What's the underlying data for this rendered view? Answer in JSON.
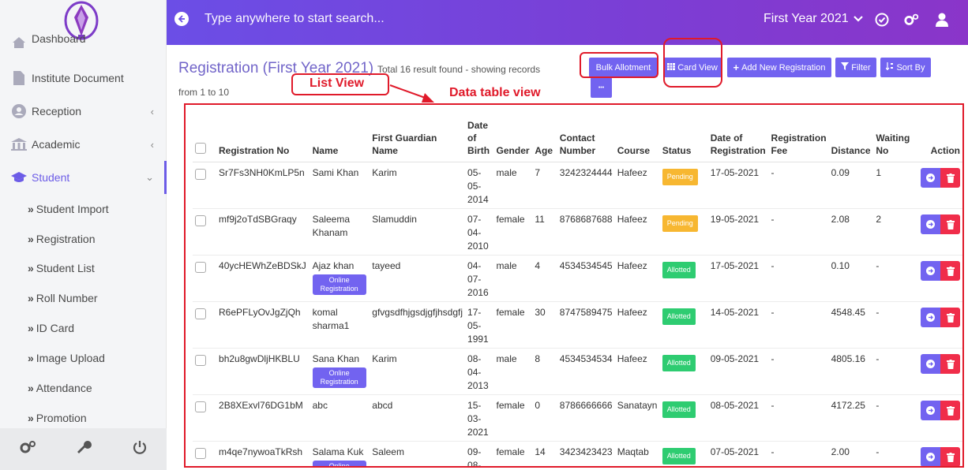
{
  "topbar": {
    "search_placeholder": "Type anywhere to start search...",
    "year": "First Year 2021",
    "accent_gradient": [
      "#6b4ee6",
      "#8a35c9"
    ]
  },
  "sidebar": {
    "items": [
      {
        "label": "Dashboard"
      },
      {
        "label": "Institute Document"
      },
      {
        "label": "Reception"
      },
      {
        "label": "Academic"
      },
      {
        "label": "Student"
      }
    ],
    "sub_items": [
      "Student Import",
      "Registration",
      "Student List",
      "Roll Number",
      "ID Card",
      "Image Upload",
      "Attendance",
      "Promotion"
    ],
    "active_color": "#6c5ce7"
  },
  "header": {
    "title": "Registration (First Year 2021)",
    "result_text": "Total 16 result found - showing records",
    "records_text": "from 1 to 10"
  },
  "toolbar": {
    "bulk_allotment": "Bulk Allotment",
    "card_view": "Card View",
    "add_new": "Add New Registration",
    "filter": "Filter",
    "sort_by": "Sort By",
    "more": "•••"
  },
  "annotations": {
    "list_view": "List View",
    "data_table_view": "Data table view"
  },
  "table": {
    "headers": [
      "Registration No",
      "Name",
      "First Guardian Name",
      "Date of Birth",
      "Gender",
      "Age",
      "Contact Number",
      "Course",
      "Status",
      "Date of Registration",
      "Registration Fee",
      "Distance",
      "Waiting No",
      "Action"
    ],
    "rows": [
      {
        "reg": "Sr7Fs3NH0KmLP5n",
        "name": "Sami Khan",
        "online": "",
        "guardian": "Karim",
        "dob": [
          "05-",
          "05-",
          "2014"
        ],
        "gender": "male",
        "age": "7",
        "contact": "3242324444",
        "course": "Hafeez",
        "status": "Pending",
        "date": "17-05-2021",
        "fee": "-",
        "distance": "0.09",
        "waiting": "1"
      },
      {
        "reg": "mf9j2oTdSBGraqy",
        "name": "Saleema Khanam",
        "online": "",
        "guardian": "Slamuddin",
        "dob": [
          "07-",
          "04-",
          "2010"
        ],
        "gender": "female",
        "age": "11",
        "contact": "8768687688",
        "course": "Hafeez",
        "status": "Pending",
        "date": "19-05-2021",
        "fee": "-",
        "distance": "2.08",
        "waiting": "2"
      },
      {
        "reg": "40ycHEWhZeBDSkJ",
        "name": "Ajaz khan",
        "online": "Online Registration",
        "guardian": "tayeed",
        "dob": [
          "04-",
          "07-",
          "2016"
        ],
        "gender": "male",
        "age": "4",
        "contact": "4534534545",
        "course": "Hafeez",
        "status": "Allotted",
        "date": "17-05-2021",
        "fee": "-",
        "distance": "0.10",
        "waiting": "-"
      },
      {
        "reg": "R6ePFLyOvJgZjQh",
        "name": "komal sharma1",
        "online": "",
        "guardian": "gfvgsdfhjgsdjgfjhsdgfj",
        "dob": [
          "17-",
          "05-",
          "1991"
        ],
        "gender": "female",
        "age": "30",
        "contact": "8747589475",
        "course": "Hafeez",
        "status": "Allotted",
        "date": "14-05-2021",
        "fee": "-",
        "distance": "4548.45",
        "waiting": "-"
      },
      {
        "reg": "bh2u8gwDljHKBLU",
        "name": "Sana Khan",
        "online": "Online Registration",
        "guardian": "Karim",
        "dob": [
          "08-",
          "04-",
          "2013"
        ],
        "gender": "male",
        "age": "8",
        "contact": "4534534534",
        "course": "Hafeez",
        "status": "Allotted",
        "date": "09-05-2021",
        "fee": "-",
        "distance": "4805.16",
        "waiting": "-"
      },
      {
        "reg": "2B8XExvl76DG1bM",
        "name": "abc",
        "online": "",
        "guardian": "abcd",
        "dob": [
          "15-",
          "03-",
          "2021"
        ],
        "gender": "female",
        "age": "0",
        "contact": "8786666666",
        "course": "Sanatayn",
        "status": "Allotted",
        "date": "08-05-2021",
        "fee": "-",
        "distance": "4172.25",
        "waiting": "-"
      },
      {
        "reg": "m4qe7nywoaTkRsh",
        "name": "Salama Kuk",
        "online": "Online",
        "guardian": "Saleem",
        "dob": [
          "09-",
          "08-",
          ""
        ],
        "gender": "female",
        "age": "14",
        "contact": "3423423423",
        "course": "Maqtab",
        "status": "Allotted",
        "date": "07-05-2021",
        "fee": "-",
        "distance": "2.00",
        "waiting": "-"
      }
    ],
    "status_colors": {
      "Pending": "#f7b731",
      "Allotted": "#2ecc71"
    }
  }
}
